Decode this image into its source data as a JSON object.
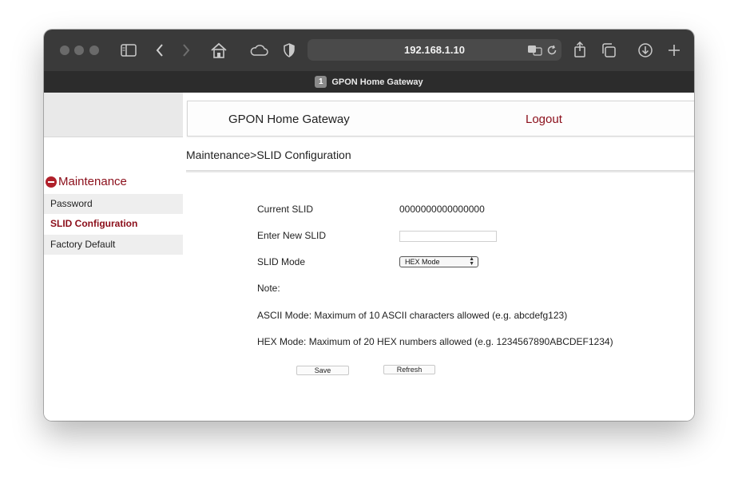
{
  "browser": {
    "url": "192.168.1.10",
    "tab_title": "GPON Home Gateway",
    "tab_number": "1"
  },
  "header": {
    "brand": "GPON Home Gateway",
    "logout": "Logout"
  },
  "breadcrumb": "Maintenance>SLID Configuration",
  "sidebar": {
    "section": "Maintenance",
    "items": [
      {
        "label": "Password"
      },
      {
        "label": "SLID Configuration"
      },
      {
        "label": "Factory Default"
      }
    ]
  },
  "form": {
    "current_slid_label": "Current SLID",
    "current_slid_value": "0000000000000000",
    "new_slid_label": "Enter New SLID",
    "new_slid_value": "",
    "mode_label": "SLID Mode",
    "mode_value": "HEX Mode",
    "note_label": "Note:",
    "ascii_note": "ASCII Mode: Maximum of 10 ASCII characters allowed (e.g. abcdefg123)",
    "hex_note": "HEX Mode: Maximum of 20 HEX numbers allowed (e.g. 1234567890ABCDEF1234)",
    "save_label": "Save",
    "refresh_label": "Refresh"
  },
  "colors": {
    "accent": "#8b0e1a",
    "toolbar": "#3a3a3a"
  }
}
